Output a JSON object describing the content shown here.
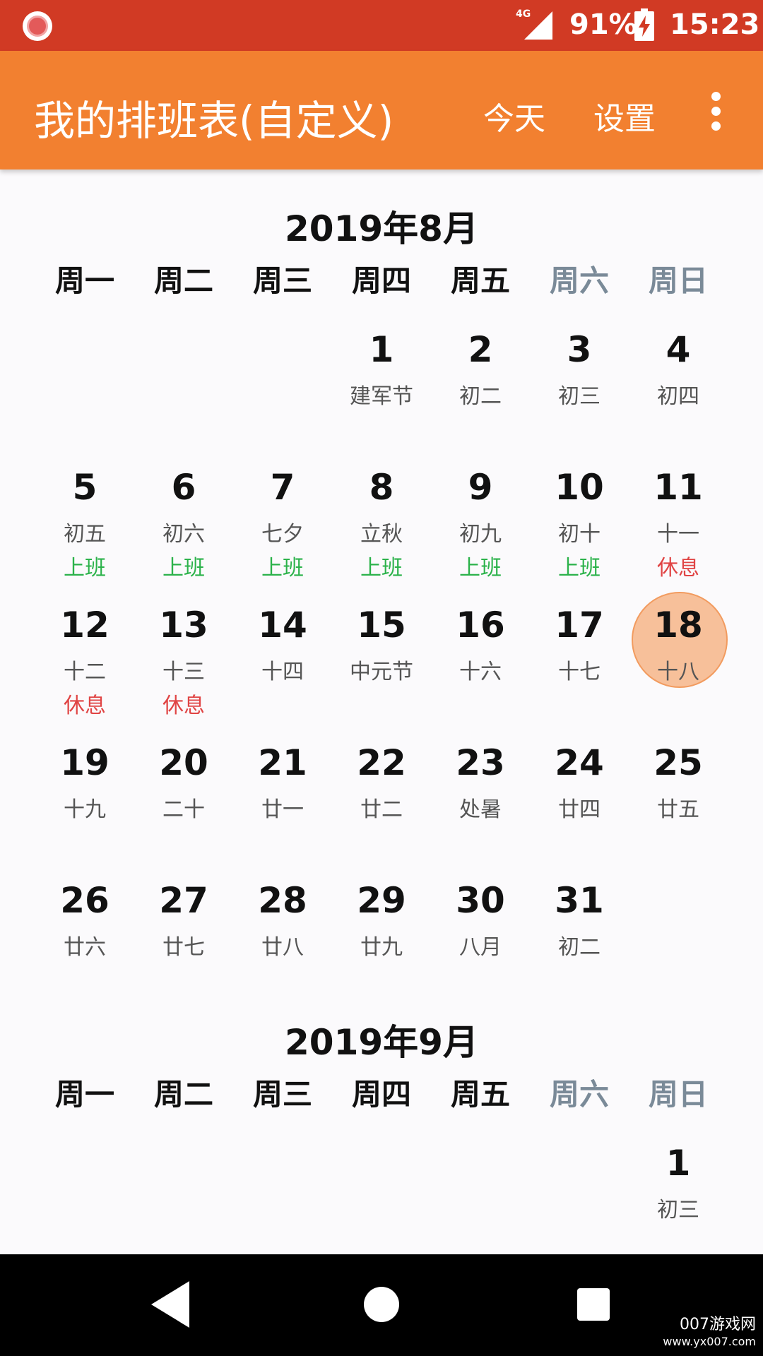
{
  "status_bar": {
    "network": "4G",
    "battery": "91%",
    "time": "15:23",
    "icons": [
      "record-icon",
      "signal-icon",
      "battery-charging-icon"
    ]
  },
  "app_bar": {
    "title": "我的排班表(自定义)",
    "today": "今天",
    "settings": "设置",
    "overflow_icon": "more-vert-icon"
  },
  "colors": {
    "status_bar": "#d13a24",
    "app_bar": "#f28030",
    "work": "#2bb24a",
    "rest": "#e04444",
    "weekend_header": "#7a8a98",
    "today_highlight": "#f7c09a"
  },
  "weekdays": [
    "周一",
    "周二",
    "周三",
    "周四",
    "周五",
    "周六",
    "周日"
  ],
  "months": [
    {
      "title": "2019年8月",
      "days": [
        {
          "num": "",
          "lunar": "",
          "shift": ""
        },
        {
          "num": "",
          "lunar": "",
          "shift": ""
        },
        {
          "num": "",
          "lunar": "",
          "shift": ""
        },
        {
          "num": "1",
          "lunar": "建军节",
          "shift": ""
        },
        {
          "num": "2",
          "lunar": "初二",
          "shift": ""
        },
        {
          "num": "3",
          "lunar": "初三",
          "shift": ""
        },
        {
          "num": "4",
          "lunar": "初四",
          "shift": ""
        },
        {
          "num": "5",
          "lunar": "初五",
          "shift": "上班"
        },
        {
          "num": "6",
          "lunar": "初六",
          "shift": "上班"
        },
        {
          "num": "7",
          "lunar": "七夕",
          "shift": "上班"
        },
        {
          "num": "8",
          "lunar": "立秋",
          "shift": "上班"
        },
        {
          "num": "9",
          "lunar": "初九",
          "shift": "上班"
        },
        {
          "num": "10",
          "lunar": "初十",
          "shift": "上班"
        },
        {
          "num": "11",
          "lunar": "十一",
          "shift": "休息"
        },
        {
          "num": "12",
          "lunar": "十二",
          "shift": "休息"
        },
        {
          "num": "13",
          "lunar": "十三",
          "shift": "休息"
        },
        {
          "num": "14",
          "lunar": "十四",
          "shift": ""
        },
        {
          "num": "15",
          "lunar": "中元节",
          "shift": ""
        },
        {
          "num": "16",
          "lunar": "十六",
          "shift": ""
        },
        {
          "num": "17",
          "lunar": "十七",
          "shift": ""
        },
        {
          "num": "18",
          "lunar": "十八",
          "shift": "",
          "today": true
        },
        {
          "num": "19",
          "lunar": "十九",
          "shift": ""
        },
        {
          "num": "20",
          "lunar": "二十",
          "shift": ""
        },
        {
          "num": "21",
          "lunar": "廿一",
          "shift": ""
        },
        {
          "num": "22",
          "lunar": "廿二",
          "shift": ""
        },
        {
          "num": "23",
          "lunar": "处暑",
          "shift": ""
        },
        {
          "num": "24",
          "lunar": "廿四",
          "shift": ""
        },
        {
          "num": "25",
          "lunar": "廿五",
          "shift": ""
        },
        {
          "num": "26",
          "lunar": "廿六",
          "shift": ""
        },
        {
          "num": "27",
          "lunar": "廿七",
          "shift": ""
        },
        {
          "num": "28",
          "lunar": "廿八",
          "shift": ""
        },
        {
          "num": "29",
          "lunar": "廿九",
          "shift": ""
        },
        {
          "num": "30",
          "lunar": "八月",
          "shift": ""
        },
        {
          "num": "31",
          "lunar": "初二",
          "shift": ""
        }
      ]
    },
    {
      "title": "2019年9月",
      "days": [
        {
          "num": "",
          "lunar": "",
          "shift": ""
        },
        {
          "num": "",
          "lunar": "",
          "shift": ""
        },
        {
          "num": "",
          "lunar": "",
          "shift": ""
        },
        {
          "num": "",
          "lunar": "",
          "shift": ""
        },
        {
          "num": "",
          "lunar": "",
          "shift": ""
        },
        {
          "num": "",
          "lunar": "",
          "shift": ""
        },
        {
          "num": "1",
          "lunar": "初三",
          "shift": ""
        }
      ]
    }
  ],
  "nav_bar": {
    "icons": [
      "back-icon",
      "home-icon",
      "recents-icon"
    ]
  },
  "watermark": {
    "main": "007游戏网",
    "sub": "www.yx007.com"
  }
}
